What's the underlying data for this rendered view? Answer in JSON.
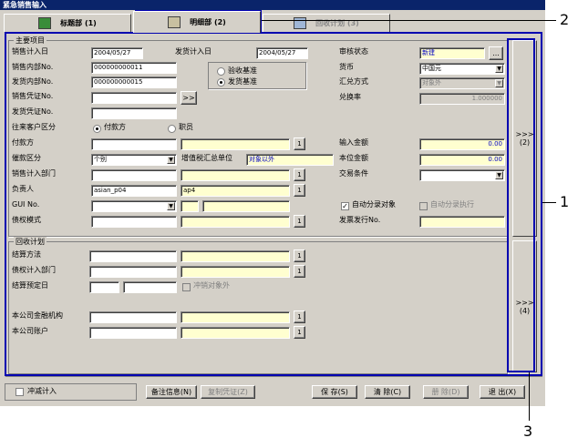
{
  "window": {
    "title": "紧急销售输入"
  },
  "tabs": [
    {
      "label": "标题部 (1)"
    },
    {
      "label": "明细部 (2)"
    },
    {
      "label": "回收计划 (3)"
    }
  ],
  "main_group": {
    "title": "主要项目",
    "sales_date_label": "销售计入日",
    "sales_date_value": "2004/05/27",
    "ship_date_label": "发货计入日",
    "ship_date_value": "2004/05/27",
    "sales_no_label": "销售内部No.",
    "sales_no_value": "000000000011",
    "ship_no_label": "发货内部No.",
    "ship_no_value": "000000000015",
    "sales_voucher_label": "销售凭证No.",
    "ship_voucher_label": "发货凭证No.",
    "voucher_btn": ">>",
    "basis_options": [
      "验收基准",
      "发货基准"
    ],
    "review_label": "审核状态",
    "review_value": "新建",
    "review_btn": "...",
    "currency_label": "货币",
    "currency_value": "中国元",
    "rate_type_label": "汇兑方式",
    "rate_type_value": "对象外",
    "rate_label": "兑换率",
    "rate_value": "1.000000",
    "customer_type_label": "往来客户区分",
    "customer_type_options": [
      "付款方",
      "职员"
    ],
    "payer_label": "付款方",
    "collect_type_label": "催款区分",
    "collect_type_value": "个别",
    "vat_label": "增值税汇总单位",
    "vat_value": "对象以外",
    "dept_label": "销售计入部门",
    "owner_label": "负责人",
    "owner_code": "asian_p04",
    "owner_name": "ap4",
    "gui_label": "GUI No.",
    "claim_mode_label": "债权模式",
    "input_amount_label": "输入金额",
    "input_amount_value": "0.00",
    "local_amount_label": "本位金额",
    "local_amount_value": "0.00",
    "trade_terms_label": "交易条件",
    "auto_split_label": "自动分录对象",
    "auto_split_exec_label": "自动分录执行",
    "invoice_no_label": "发票发行No.",
    "lookup_btn": "1"
  },
  "collect_group": {
    "title": "回收计划",
    "method_label": "结算方法",
    "claim_dept_label": "债权计入部门",
    "due_date_label": "结算预定日",
    "offset_label": "冲销对象外",
    "bank_label": "本公司金融机构",
    "account_label": "本公司账户"
  },
  "side_buttons": [
    {
      "arrows": ">>>",
      "label": "(2)"
    },
    {
      "arrows": ">>>",
      "label": "(4)"
    }
  ],
  "bottom": {
    "writeoff_label": "冲减计入",
    "memo_btn": "备注信息(N)",
    "copy_btn": "复制凭证(Z)",
    "save_btn": "保 存(S)",
    "clear_btn": "清 除(C)",
    "delete_btn": "册 除(D)",
    "exit_btn": "退 出(X)"
  },
  "callouts": [
    "1",
    "2",
    "3"
  ]
}
